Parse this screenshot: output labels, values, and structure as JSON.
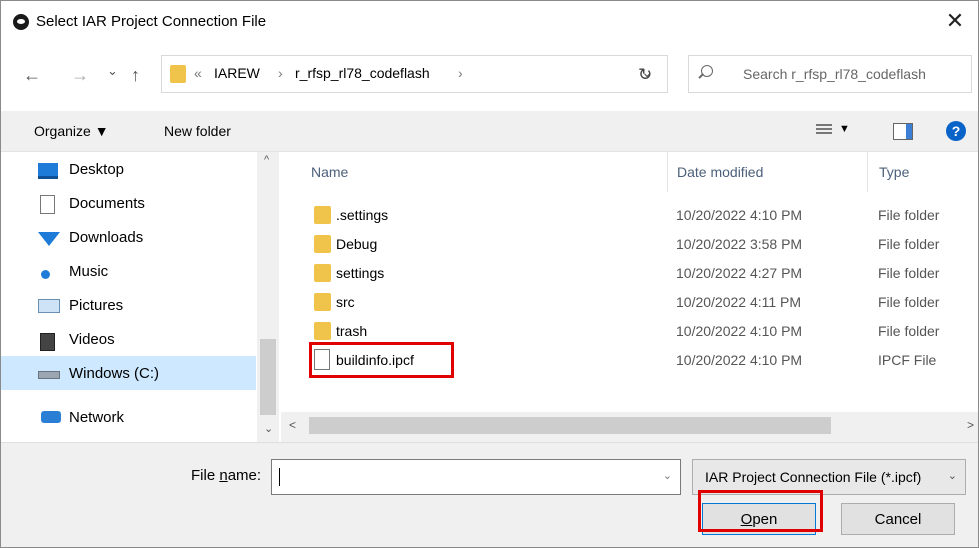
{
  "window": {
    "title": "Select IAR Project Connection File",
    "close_glyph": "✕"
  },
  "nav": {
    "back_glyph": "←",
    "forward_glyph": "→",
    "recent_glyph": "⌄",
    "up_glyph": "↑",
    "breadcrumb": [
      "«",
      "IAREW",
      "›",
      "r_rfsp_rl78_codeflash",
      "›"
    ],
    "dropdown_glyph": "⌄",
    "refresh_glyph": "↻",
    "search_placeholder": "Search r_rfsp_rl78_codeflash"
  },
  "toolbar": {
    "organize": "Organize ▼",
    "new_folder": "New folder",
    "view_dropdown": "▼",
    "help": "?"
  },
  "sidebar": {
    "items": [
      {
        "label": "Desktop",
        "icon": "desktop-icon"
      },
      {
        "label": "Documents",
        "icon": "documents-icon"
      },
      {
        "label": "Downloads",
        "icon": "downloads-icon"
      },
      {
        "label": "Music",
        "icon": "music-icon"
      },
      {
        "label": "Pictures",
        "icon": "pictures-icon"
      },
      {
        "label": "Videos",
        "icon": "videos-icon"
      },
      {
        "label": "Windows (C:)",
        "icon": "drive-icon",
        "selected": true
      },
      {
        "label": "Network",
        "icon": "network-icon"
      }
    ],
    "scroll_up": "^",
    "scroll_down": "⌄"
  },
  "filelist": {
    "columns": {
      "name": "Name",
      "date": "Date modified",
      "type": "Type"
    },
    "rows": [
      {
        "name": ".settings",
        "date": "10/20/2022 4:10 PM",
        "type": "File folder",
        "kind": "folder"
      },
      {
        "name": "Debug",
        "date": "10/20/2022 3:58 PM",
        "type": "File folder",
        "kind": "folder"
      },
      {
        "name": "settings",
        "date": "10/20/2022 4:27 PM",
        "type": "File folder",
        "kind": "folder"
      },
      {
        "name": "src",
        "date": "10/20/2022 4:11 PM",
        "type": "File folder",
        "kind": "folder"
      },
      {
        "name": "trash",
        "date": "10/20/2022 4:10 PM",
        "type": "File folder",
        "kind": "folder"
      },
      {
        "name": "buildinfo.ipcf",
        "date": "10/20/2022 4:10 PM",
        "type": "IPCF File",
        "kind": "file"
      }
    ],
    "hscroll_left": "<",
    "hscroll_right": ">"
  },
  "bottom": {
    "file_name_label_pre": "File ",
    "file_name_label_u": "n",
    "file_name_label_post": "ame:",
    "file_name_value": "",
    "file_name_dropdown": "⌄",
    "filter": "IAR Project Connection File (*.ipcf)",
    "filter_dropdown": "⌄",
    "open_u": "O",
    "open_rest": "pen",
    "cancel": "Cancel"
  },
  "colors": {
    "highlight": "#e00000",
    "selection": "#cde8ff",
    "folder": "#f0c44a"
  }
}
